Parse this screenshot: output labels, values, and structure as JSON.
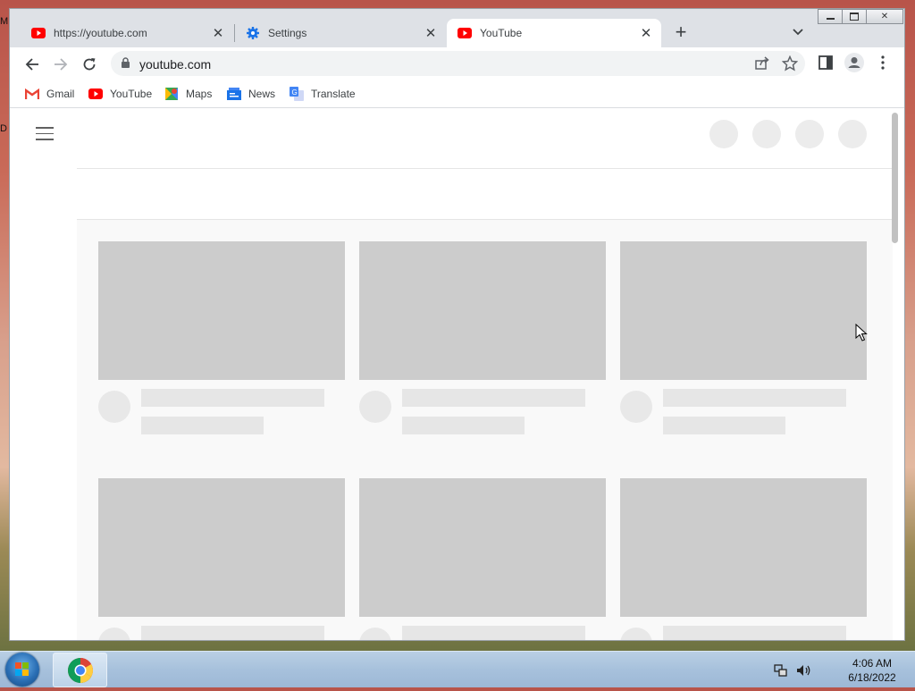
{
  "desktop": {
    "fragment_top": "M",
    "fragment_mid": "D"
  },
  "browser": {
    "tabs": [
      {
        "title": "https://youtube.com",
        "icon": "youtube-icon",
        "active": false
      },
      {
        "title": "Settings",
        "icon": "gear-icon",
        "active": false
      },
      {
        "title": "YouTube",
        "icon": "youtube-icon",
        "active": true
      }
    ],
    "new_tab_label": "+",
    "omnibox": {
      "url": "youtube.com"
    },
    "bookmarks": [
      {
        "label": "Gmail",
        "icon": "gmail-icon"
      },
      {
        "label": "YouTube",
        "icon": "youtube-icon"
      },
      {
        "label": "Maps",
        "icon": "maps-icon"
      },
      {
        "label": "News",
        "icon": "news-icon"
      },
      {
        "label": "Translate",
        "icon": "translate-icon"
      }
    ]
  },
  "colors": {
    "youtube_red": "#ff0000",
    "chrome_blue": "#1a73e8",
    "skeleton_gray": "#cccccc"
  },
  "taskbar": {
    "time": "4:06 AM",
    "date": "6/18/2022"
  }
}
